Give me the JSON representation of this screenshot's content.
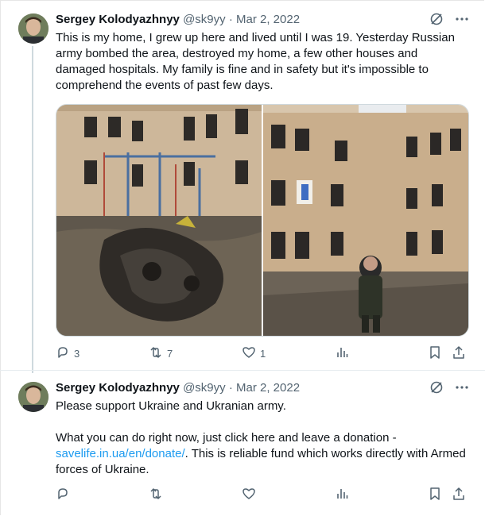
{
  "tweets": [
    {
      "author_name": "Sergey Kolodyazhnyy",
      "handle": "@sk9yy",
      "separator": "·",
      "date": "Mar 2, 2022",
      "text": "This is my home, I grew up here and lived until I was 19. Yesterday Russian army bombed the area, destroyed my home, a few other houses and damaged hospitals. My family is fine and in safety but it's impossible to comprehend the events of past few days.",
      "replies": "3",
      "retweets": "7",
      "likes": "1"
    },
    {
      "author_name": "Sergey Kolodyazhnyy",
      "handle": "@sk9yy",
      "separator": "·",
      "date": "Mar 2, 2022",
      "text_line1": "Please support Ukraine and Ukranian army.",
      "text_pre_link": "What you can do right now, just click here and leave a donation - ",
      "link_text": "savelife.in.ua/en/donate/",
      "text_post_link": ". This is reliable fund which works directly with Armed forces of Ukraine."
    }
  ],
  "icons": {
    "grok": "grok-icon",
    "more": "more-icon",
    "reply": "reply-icon",
    "retweet": "retweet-icon",
    "like": "like-icon",
    "views": "views-icon",
    "bookmark": "bookmark-icon",
    "share": "share-icon"
  },
  "colors": {
    "link": "#1d9bf0",
    "secondary_text": "#536471",
    "primary_text": "#0f1419"
  }
}
